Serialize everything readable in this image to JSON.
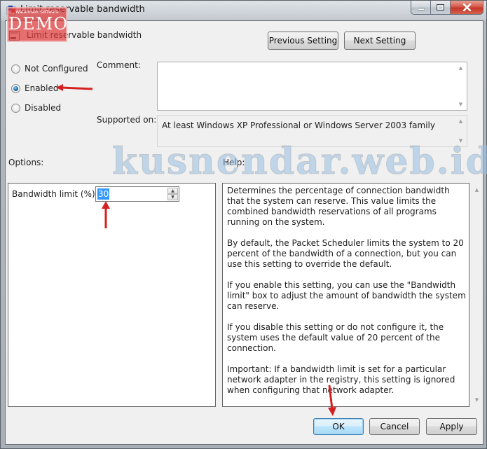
{
  "window": {
    "title": "Limit reservable bandwidth",
    "caption_buttons": [
      "minimize",
      "maximize",
      "close"
    ]
  },
  "header": {
    "policy_name": "Limit reservable bandwidth",
    "previous_label": "Previous Setting",
    "next_label": "Next Setting"
  },
  "state": {
    "options": [
      {
        "label": "Not Configured",
        "checked": false
      },
      {
        "label": "Enabled",
        "checked": true
      },
      {
        "label": "Disabled",
        "checked": false
      }
    ]
  },
  "comment": {
    "label": "Comment:",
    "value": ""
  },
  "supported": {
    "label": "Supported on:",
    "value": "At least Windows XP Professional or Windows Server 2003 family"
  },
  "options_section": {
    "label": "Options:",
    "bandwidth_label": "Bandwidth limit (%):",
    "bandwidth_value": "30"
  },
  "help_section": {
    "label": "Help:",
    "paragraphs": [
      "Determines the percentage of connection bandwidth that the system can reserve. This value limits the combined bandwidth reservations of all programs running on the system.",
      "By default, the Packet Scheduler limits the system to 20 percent of the bandwidth of a connection, but you can use this setting to override the default.",
      "If you enable this setting, you can use the \"Bandwidth limit\" box to adjust the amount of bandwidth the system can reserve.",
      "If you disable this setting or do not configure it, the system uses the default value of 20 percent of the connection.",
      "Important: If a bandwidth limit is set for a particular network adapter in the registry, this setting is ignored when configuring that network adapter."
    ]
  },
  "footer": {
    "ok_label": "OK",
    "cancel_label": "Cancel",
    "apply_label": "Apply"
  },
  "overlays": {
    "watermark_text": "kusnendar.web.id",
    "demo_small": "Watermark Software",
    "demo_big": "DEMO",
    "annotation_color": "#d42020"
  }
}
